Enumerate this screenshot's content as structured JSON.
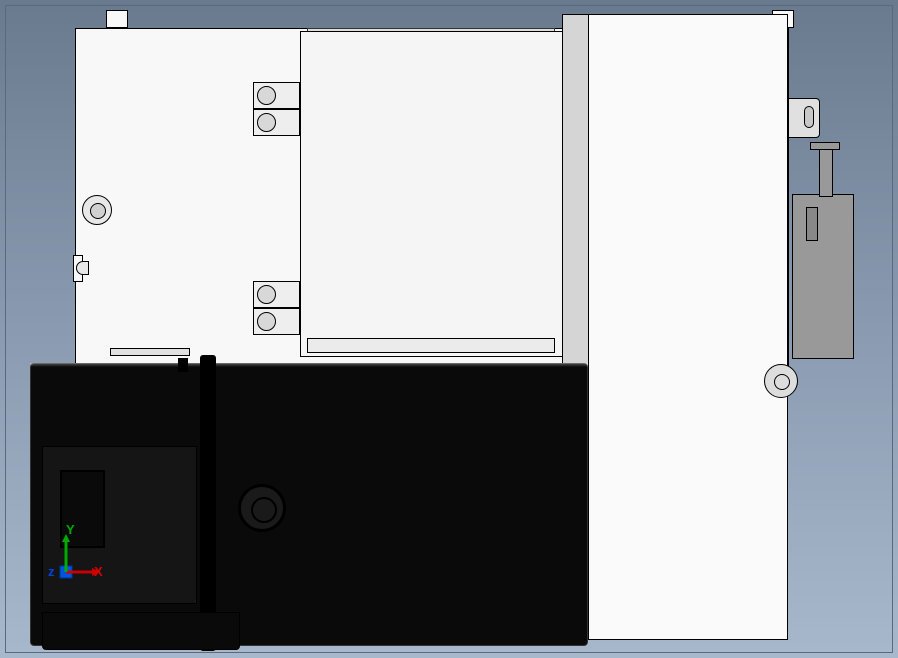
{
  "viewport": {
    "type": "CAD 3D viewport",
    "view": "front-orthographic",
    "background": "gradient-steel-blue"
  },
  "coordinate_system": {
    "x": {
      "label": "X",
      "color": "#cc0000",
      "direction": "right"
    },
    "y": {
      "label": "Y",
      "color": "#00aa00",
      "direction": "up"
    },
    "z": {
      "label": "z",
      "color": "#0044dd",
      "direction": "out"
    }
  },
  "assembly": {
    "parts": [
      {
        "name": "main-housing-plate",
        "color": "#f8f8f8"
      },
      {
        "name": "center-cover-panel",
        "color": "#f5f5f5"
      },
      {
        "name": "servo-motor",
        "color": "#0a0a0a"
      },
      {
        "name": "right-mounting-bracket",
        "color": "#999999"
      },
      {
        "name": "right-front-block",
        "color": "#fafafa"
      },
      {
        "name": "standoffs",
        "count": 4
      },
      {
        "name": "mounting-bolts",
        "count": 2
      }
    ]
  }
}
